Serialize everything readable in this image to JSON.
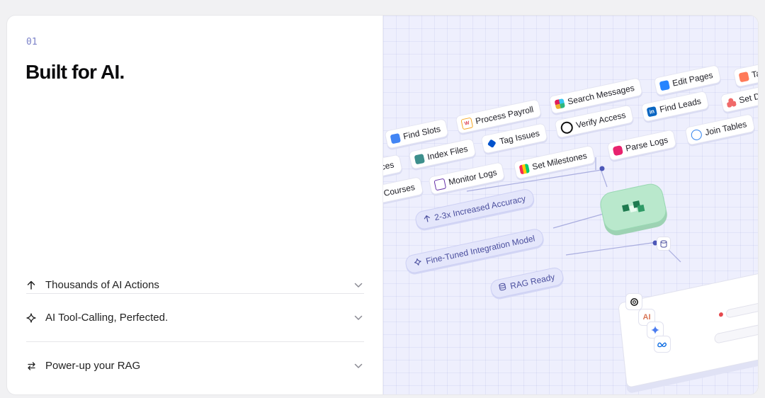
{
  "section": {
    "step": "01",
    "title": "Built for AI."
  },
  "accordion": [
    {
      "label": "Thousands of AI Actions",
      "icon": "arrow-up-icon"
    },
    {
      "label": "AI Tool-Calling, Perfected.",
      "icon": "sparkle-icon"
    },
    {
      "label": "Power-up your RAG",
      "icon": "swap-arrows-icon"
    }
  ],
  "illustration": {
    "row1": [
      "Find Slots",
      "Process Payroll",
      "Search Messages",
      "Edit Pages",
      "Ta"
    ],
    "row2": [
      "ces",
      "Index Files",
      "Tag Issues",
      "Verify Access",
      "Find Leads",
      "Set D"
    ],
    "row3": [
      "Courses",
      "Monitor Logs",
      "Set Milestones",
      "Parse Logs",
      "Join Tables"
    ],
    "pills": [
      "2-3x Increased Accuracy",
      "Fine-Tuned Integration Model",
      "RAG Ready"
    ],
    "model_badges": [
      "AI"
    ]
  },
  "colors": {
    "accent": "#7b82c9",
    "hub_green": "#b9e8cc",
    "pill_bg": "#e4e6fb"
  }
}
